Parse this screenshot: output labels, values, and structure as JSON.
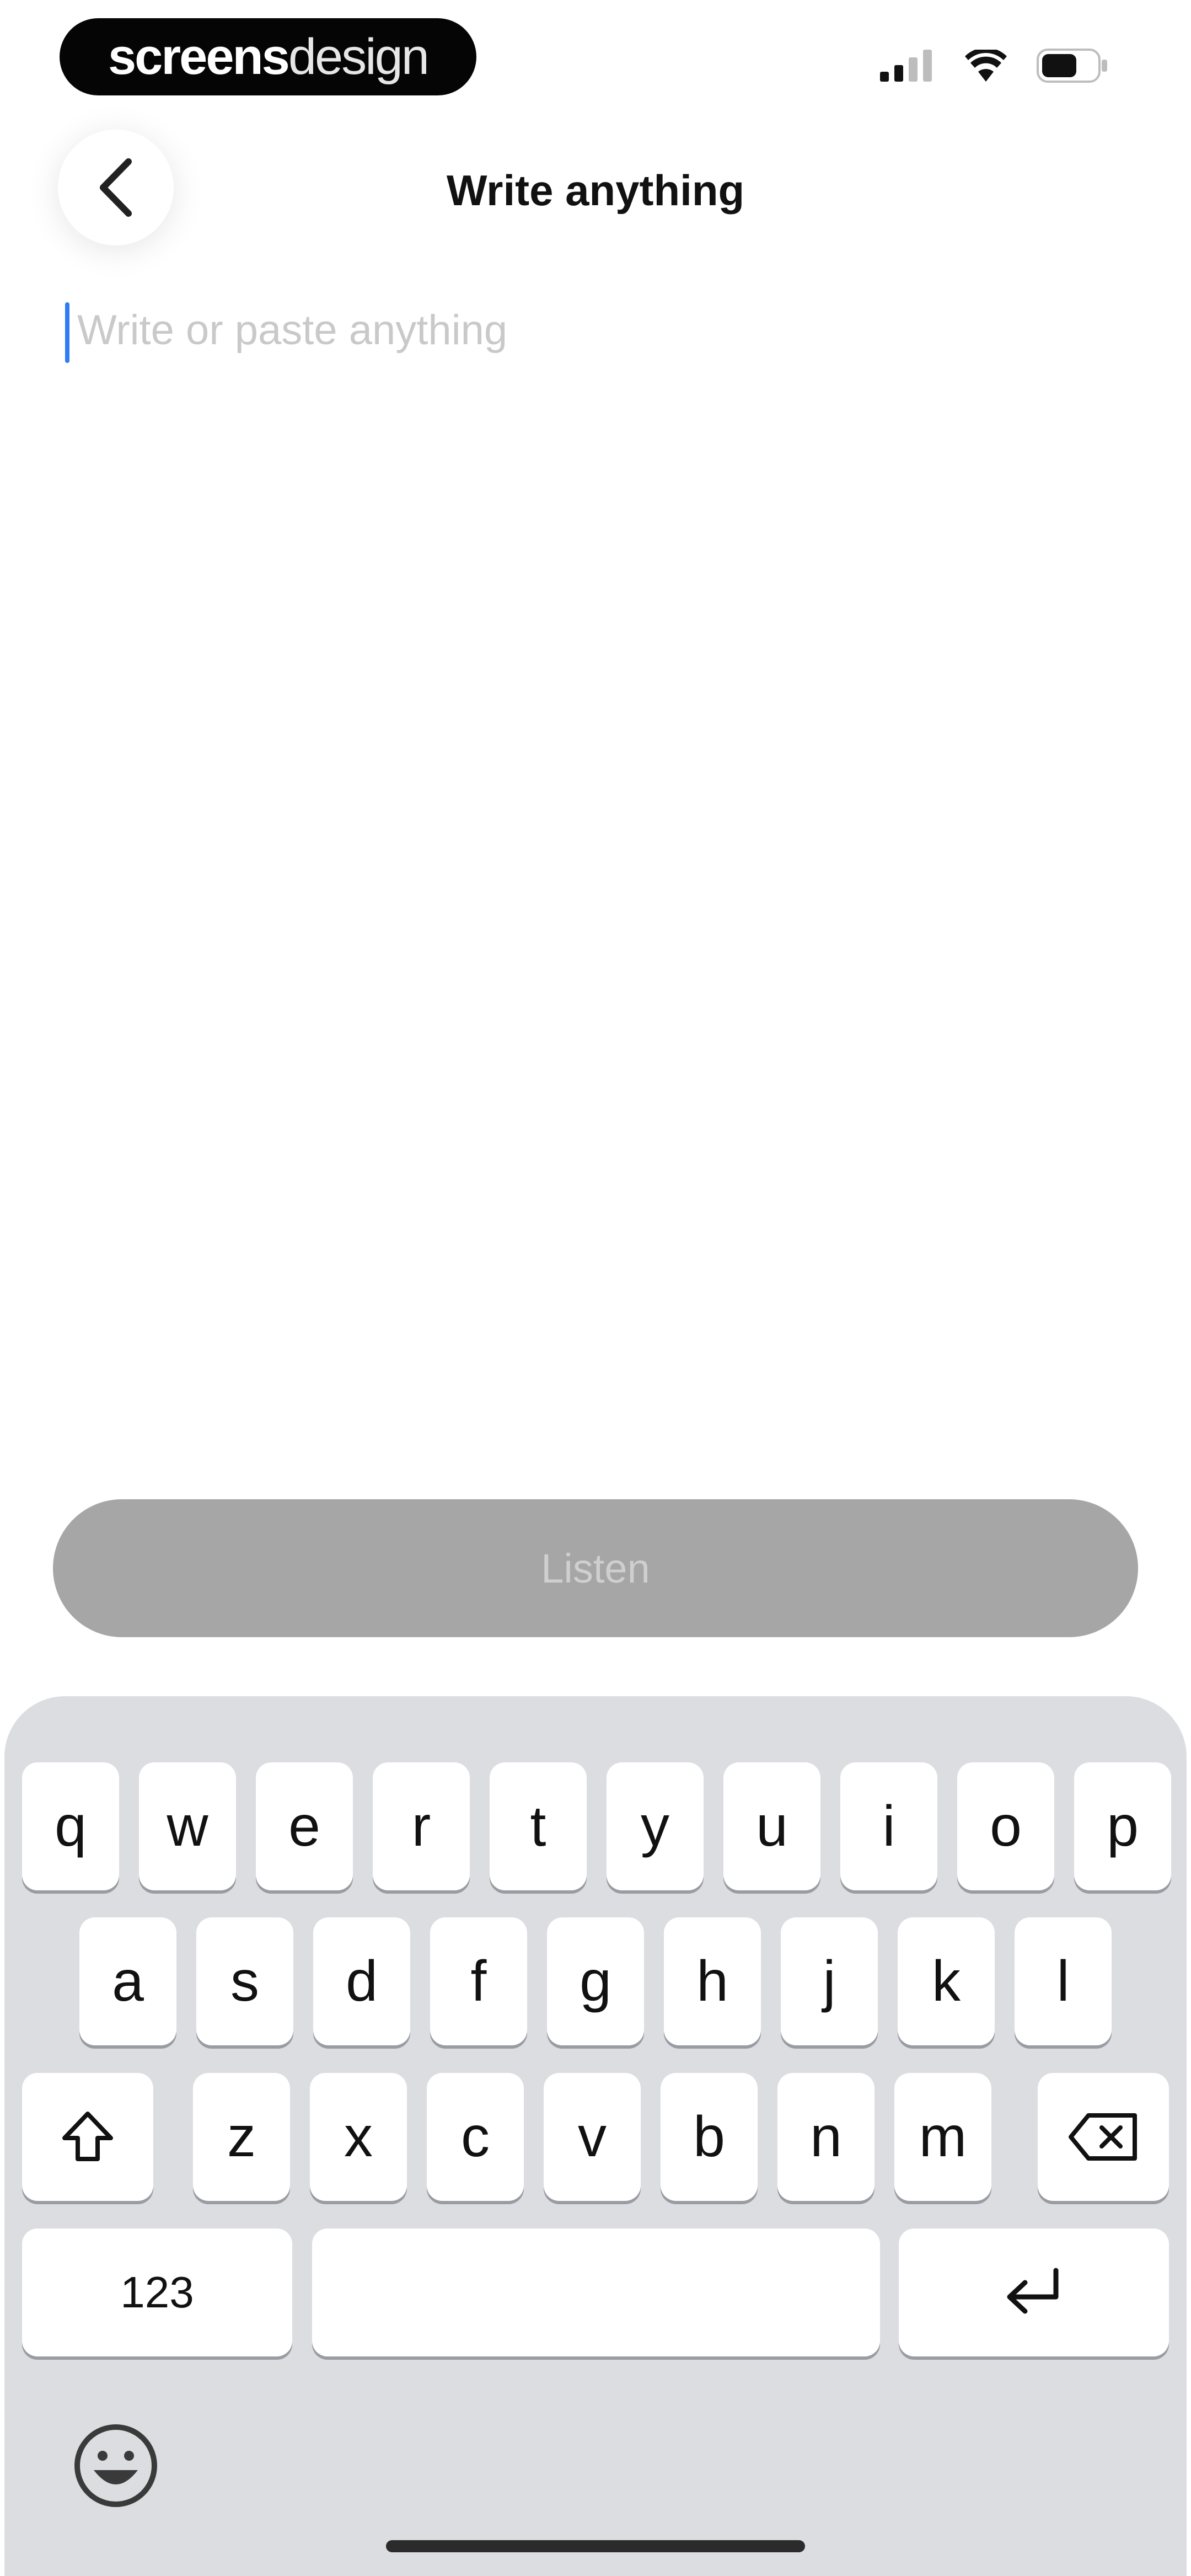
{
  "status_bar": {
    "brand_bold": "screens",
    "brand_light": "design",
    "icons": [
      "cellular-signal-icon",
      "wifi-icon",
      "battery-icon"
    ]
  },
  "header": {
    "back_icon": "chevron-left-icon",
    "title": "Write anything"
  },
  "editor": {
    "placeholder": "Write or paste anything",
    "value": ""
  },
  "action": {
    "listen_label": "Listen",
    "enabled": false
  },
  "keyboard": {
    "row1": [
      "q",
      "w",
      "e",
      "r",
      "t",
      "y",
      "u",
      "i",
      "o",
      "p"
    ],
    "row2": [
      "a",
      "s",
      "d",
      "f",
      "g",
      "h",
      "j",
      "k",
      "l"
    ],
    "row3": [
      "z",
      "x",
      "c",
      "v",
      "b",
      "n",
      "m"
    ],
    "numbers_label": "123",
    "icons": [
      "shift-icon",
      "backspace-icon",
      "return-icon",
      "emoji-icon"
    ]
  },
  "colors": {
    "accent_caret": "#2f7cf6",
    "listen_disabled": "#a6a6a6",
    "keyboard_bg": "#dcdde1"
  }
}
